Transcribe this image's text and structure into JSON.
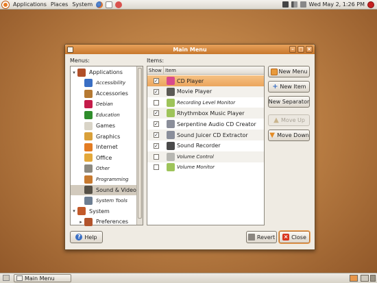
{
  "top_panel": {
    "menus": [
      "Applications",
      "Places",
      "System"
    ],
    "clock": "Wed May  2,  1:26 PM"
  },
  "bottom_panel": {
    "task_label": "Main Menu"
  },
  "window": {
    "title": "Main Menu",
    "menus_label": "Menus:",
    "items_label": "Items:",
    "menus_tree": [
      {
        "label": "Applications",
        "italic": false,
        "level": 0,
        "expanded": true,
        "color": "#b0502a"
      },
      {
        "label": "Accessibility",
        "italic": true,
        "level": 1,
        "color": "#3a6fc4"
      },
      {
        "label": "Accessories",
        "italic": false,
        "level": 1,
        "color": "#b57932"
      },
      {
        "label": "Debian",
        "italic": true,
        "level": 1,
        "color": "#c41c4a"
      },
      {
        "label": "Education",
        "italic": true,
        "level": 1,
        "color": "#2f8d2c"
      },
      {
        "label": "Games",
        "italic": false,
        "level": 1,
        "color": "#d9d4c7"
      },
      {
        "label": "Graphics",
        "italic": false,
        "level": 1,
        "color": "#d9a03a"
      },
      {
        "label": "Internet",
        "italic": false,
        "level": 1,
        "color": "#e37c22"
      },
      {
        "label": "Office",
        "italic": false,
        "level": 1,
        "color": "#e3a83a"
      },
      {
        "label": "Other",
        "italic": true,
        "level": 1,
        "color": "#8d8a80"
      },
      {
        "label": "Programming",
        "italic": true,
        "level": 1,
        "color": "#c77a2f"
      },
      {
        "label": "Sound & Video",
        "italic": false,
        "level": 1,
        "selected": true,
        "color": "#555046"
      },
      {
        "label": "System Tools",
        "italic": true,
        "level": 1,
        "color": "#6d7e92"
      },
      {
        "label": "System",
        "italic": false,
        "level": 0,
        "expanded": true,
        "color": "#c25a2a"
      },
      {
        "label": "Preferences",
        "italic": false,
        "level": 1,
        "collapsed": true,
        "color": "#b2542c"
      }
    ],
    "items_columns": [
      "Show",
      "Item"
    ],
    "items": [
      {
        "label": "CD Player",
        "checked": true,
        "italic": false,
        "selected": true,
        "color": "#d94a8c"
      },
      {
        "label": "Movie Player",
        "checked": true,
        "italic": false,
        "color": "#5b5a55"
      },
      {
        "label": "Recording Level Monitor",
        "checked": false,
        "italic": true,
        "color": "#9ec45a"
      },
      {
        "label": "Rhythmbox Music Player",
        "checked": true,
        "italic": false,
        "color": "#9ec45a"
      },
      {
        "label": "Serpentine Audio CD Creator",
        "checked": true,
        "italic": false,
        "color": "#8a8e9a"
      },
      {
        "label": "Sound Juicer CD Extractor",
        "checked": true,
        "italic": false,
        "color": "#8a8e9a"
      },
      {
        "label": "Sound Recorder",
        "checked": true,
        "italic": false,
        "color": "#4a4a4a"
      },
      {
        "label": "Volume Control",
        "checked": false,
        "italic": true,
        "color": "#b7b7b2"
      },
      {
        "label": "Volume Monitor",
        "checked": false,
        "italic": true,
        "color": "#9ec45a"
      }
    ],
    "buttons": {
      "new_menu": "New Menu",
      "new_item": "New Item",
      "new_separator": "New Separator",
      "move_up": "Move Up",
      "move_down": "Move Down",
      "help": "Help",
      "revert": "Revert",
      "close": "Close"
    }
  }
}
